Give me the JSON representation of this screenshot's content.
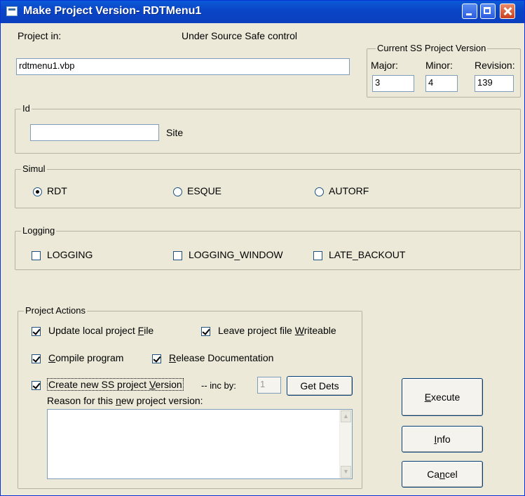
{
  "window": {
    "title": "Make Project Version- RDTMenu1"
  },
  "project": {
    "label": "Project in:",
    "status": "Under Source Safe control",
    "file_value": "rdtmenu1.vbp"
  },
  "version": {
    "legend": "Current SS Project Version",
    "major_label": "Major:",
    "major_value": "3",
    "minor_label": "Minor:",
    "minor_value": "4",
    "revision_label": "Revision:",
    "revision_value": "139"
  },
  "id_group": {
    "legend": "Id",
    "site_value": "",
    "site_label": "Site"
  },
  "simul": {
    "legend": "Simul",
    "options": [
      {
        "label": "RDT",
        "checked": true
      },
      {
        "label": "ESQUE",
        "checked": false
      },
      {
        "label": "AUTORF",
        "checked": false
      }
    ]
  },
  "logging": {
    "legend": "Logging",
    "options": [
      {
        "label": "LOGGING",
        "checked": false
      },
      {
        "label": "LOGGING_WINDOW",
        "checked": false
      },
      {
        "label": "LATE_BACKOUT",
        "checked": false
      }
    ]
  },
  "actions": {
    "legend": "Project Actions",
    "update_pre": "Update local project ",
    "update_acc": "F",
    "update_post": "ile",
    "leave_pre": "Leave project file ",
    "leave_acc": "W",
    "leave_post": "riteable",
    "compile_acc": "C",
    "compile_post": "ompile program",
    "release_acc": "R",
    "release_post": "elease Documentation",
    "create_pre": "Create new SS project ",
    "create_acc": "V",
    "create_post": "ersion",
    "inc_label": "-- inc by:",
    "inc_value": "1",
    "get_dets": "Get Dets",
    "reason_pre": "Reason for this ",
    "reason_acc": "n",
    "reason_post": "ew project version:",
    "reason_value": ""
  },
  "buttons": {
    "execute_acc": "E",
    "execute_post": "xecute",
    "info_acc": "I",
    "info_post": "nfo",
    "cancel_pre": "Ca",
    "cancel_acc": "n",
    "cancel_post": "cel"
  }
}
